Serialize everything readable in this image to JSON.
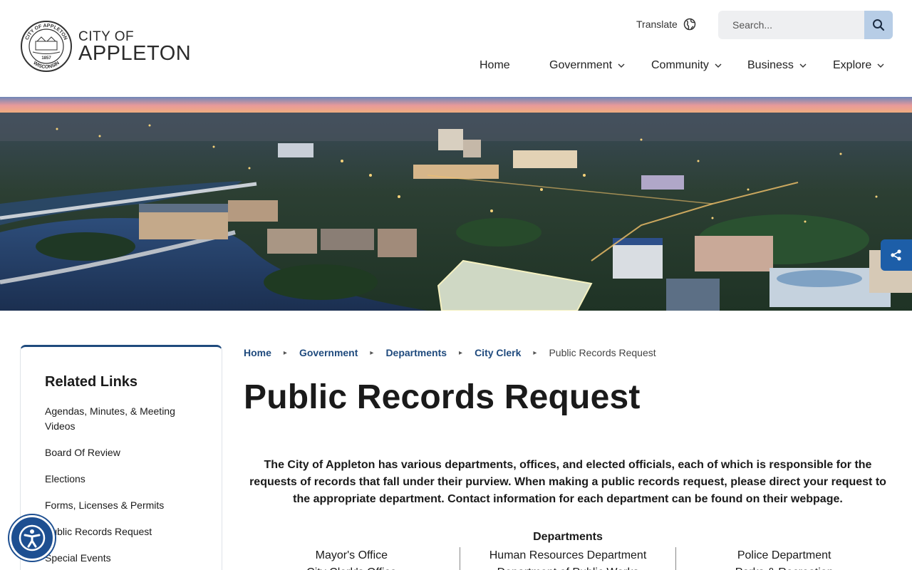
{
  "header": {
    "logo": {
      "line1": "CITY OF",
      "line2": "APPLETON",
      "seal_text_top": "CITY OF APPLETON",
      "seal_text_year": "1857",
      "seal_text_bottom": "WISCONSIN",
      "seal_text_side": "INCORPORATED"
    },
    "translate_label": "Translate",
    "search": {
      "placeholder": "Search..."
    },
    "nav": [
      {
        "label": "Home",
        "dropdown": false
      },
      {
        "label": "Government",
        "dropdown": true
      },
      {
        "label": "Community",
        "dropdown": true
      },
      {
        "label": "Business",
        "dropdown": true
      },
      {
        "label": "Explore",
        "dropdown": true
      }
    ]
  },
  "sidebar": {
    "title": "Related Links",
    "items": [
      "Agendas, Minutes, & Meeting Videos",
      "Board Of Review",
      "Elections",
      "Forms, Licenses & Permits",
      "Public Records Request",
      "Special Events"
    ]
  },
  "breadcrumb": {
    "items": [
      "Home",
      "Government",
      "Departments",
      "City Clerk"
    ],
    "current": "Public Records Request"
  },
  "main": {
    "title": "Public Records Request",
    "intro": "The City of Appleton has various departments, offices, and elected officials, each of which is responsible for the requests of records that fall under their purview. When making a public records request, please direct your request to the appropriate department. Contact information for each department can be found on their webpage.",
    "departments_heading": "Departments",
    "departments": [
      [
        "Mayor's Office",
        "City Clerk's Office"
      ],
      [
        "Human Resources Department",
        "Department of Public Works"
      ],
      [
        "Police Department",
        "Parks & Recreation"
      ]
    ]
  },
  "colors": {
    "brand": "#1f4a7d",
    "search_button": "#b7cde6",
    "share_button": "#1d5ea8",
    "accessibility": "#1d4f91"
  },
  "icons": {
    "translate": "globe-icon",
    "search": "search-icon",
    "share": "share-icon",
    "accessibility": "accessibility-icon",
    "dropdown": "chevron-down-icon"
  }
}
